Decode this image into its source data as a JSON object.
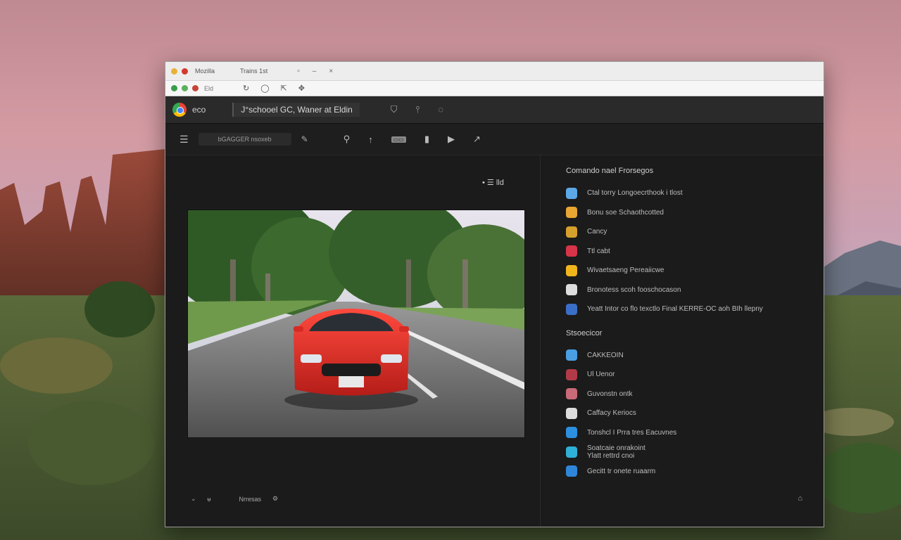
{
  "window": {
    "title_left": "Mozilla",
    "title_tab": "Trains 1st",
    "address": "Eld",
    "app_name": "eco",
    "doc_title": "J°schooel GC, Waner at Eldin",
    "breadcrumb": "bGAGGER nsoxeb"
  },
  "viewer": {
    "icons_text": "• ☰ lld"
  },
  "bottom": {
    "label": "Nrresas"
  },
  "sidebar": {
    "section1_title": "Comando nael Frorsegos",
    "section1_items": [
      {
        "label": "Ctal torry Longoecrthook i tlost",
        "icon": "figure-icon",
        "color": "#5ca7e6"
      },
      {
        "label": "Bonu soe Schaothcotted",
        "icon": "warning-icon",
        "color": "#e8a632"
      },
      {
        "label": "Cancy",
        "icon": "chrome-icon",
        "color": "#d6a02c"
      },
      {
        "label": "Ttl cabt",
        "icon": "red-app-icon",
        "color": "#d7344a"
      },
      {
        "label": "Wivaetsaeng Pereaiicwe",
        "icon": "yellow-app-icon",
        "color": "#f1b51c"
      },
      {
        "label": "Bronotess scoh fooschocason",
        "icon": "droplet-icon",
        "color": "#dddddd"
      },
      {
        "label": "Yeatt Intor co flo texctlo Final KERRE-OC aoh BIh llepny",
        "icon": "blue-app-icon",
        "color": "#3b6fc7"
      }
    ],
    "section2_title": "Stsoecicor",
    "section2_items": [
      {
        "label": "CAKKEOIN",
        "icon": "globe-icon",
        "color": "#4a9fe3"
      },
      {
        "label": "Ul Uenor",
        "icon": "chrome-icon",
        "color": "#b23a48"
      },
      {
        "label": "Guvonstn ontk",
        "icon": "folder-icon",
        "color": "#c96a78"
      },
      {
        "label": "Caffacy Keriocs",
        "icon": "square-app-icon",
        "color": "#dddddd"
      },
      {
        "label": "Tonshcl I Prra tres Eacuvnes",
        "icon": "blue-app-icon",
        "color": "#2d8fe0"
      },
      {
        "label": "Soatcaie onrakoint\nYlatt rettrd cnoi",
        "icon": "chat-icon",
        "color": "#2fb0d6"
      },
      {
        "label": "Gecitt tr onete ruaarm",
        "icon": "photo-app-icon",
        "color": "#2f86d8"
      }
    ]
  },
  "colors": {
    "window_bg": "#1b1b1b",
    "header_bg": "#2a2a2a",
    "car_red": "#e0312d"
  }
}
